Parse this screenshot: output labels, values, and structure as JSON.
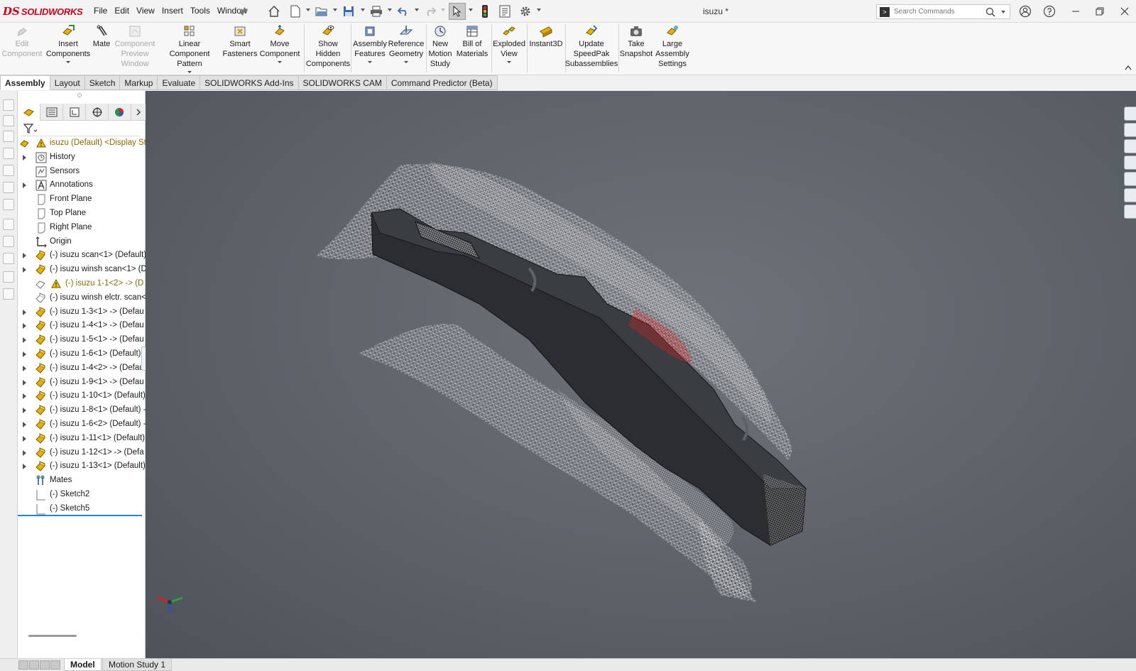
{
  "app": {
    "brand_mark": "DS",
    "brand_name": "SOLIDWORKS",
    "document_title": "isuzu *"
  },
  "menus": [
    "File",
    "Edit",
    "View",
    "Insert",
    "Tools",
    "Window"
  ],
  "search": {
    "placeholder": "Search Commands"
  },
  "commands": [
    {
      "label": "Edit\nComponent",
      "enabled": false
    },
    {
      "label": "Insert\nComponents",
      "enabled": true
    },
    {
      "label": "Mate",
      "enabled": true
    },
    {
      "label": "Component\nPreview\nWindow",
      "enabled": false
    },
    {
      "label": "Linear Component\nPattern",
      "enabled": true
    },
    {
      "label": "Smart\nFasteners",
      "enabled": true
    },
    {
      "label": "Move\nComponent",
      "enabled": true
    },
    {
      "label": "Show\nHidden\nComponents",
      "enabled": true
    },
    {
      "label": "Assembly\nFeatures",
      "enabled": true
    },
    {
      "label": "Reference\nGeometry",
      "enabled": true
    },
    {
      "label": "New\nMotion\nStudy",
      "enabled": true
    },
    {
      "label": "Bill of\nMaterials",
      "enabled": true
    },
    {
      "label": "Exploded\nView",
      "enabled": true
    },
    {
      "label": "Instant3D",
      "enabled": true
    },
    {
      "label": "Update\nSpeedPak\nSubassemblies",
      "enabled": true
    },
    {
      "label": "Take\nSnapshot",
      "enabled": true
    },
    {
      "label": "Large\nAssembly\nSettings",
      "enabled": true
    }
  ],
  "command_tabs": [
    "Assembly",
    "Layout",
    "Sketch",
    "Markup",
    "Evaluate",
    "SOLIDWORKS Add-Ins",
    "SOLIDWORKS CAM",
    "Command Predictor (Beta)"
  ],
  "active_command_tab": "Assembly",
  "tree": [
    {
      "label": "isuzu (Default) <Display St",
      "icon": "assembly-warning-icon",
      "expandable": false,
      "kind": "root"
    },
    {
      "label": "History",
      "icon": "history-icon",
      "expandable": true
    },
    {
      "label": "Sensors",
      "icon": "sensors-icon",
      "expandable": false
    },
    {
      "label": "Annotations",
      "icon": "annotations-icon",
      "expandable": true
    },
    {
      "label": "Front Plane",
      "icon": "plane-icon",
      "expandable": false
    },
    {
      "label": "Top Plane",
      "icon": "plane-icon",
      "expandable": false
    },
    {
      "label": "Right Plane",
      "icon": "plane-icon",
      "expandable": false
    },
    {
      "label": "Origin",
      "icon": "origin-icon",
      "expandable": false
    },
    {
      "label": "(-) isuzu scan<1> (Default)",
      "icon": "part-icon",
      "expandable": true
    },
    {
      "label": "(-) isuzu winsh scan<1> (D",
      "icon": "part-icon",
      "expandable": true
    },
    {
      "label": "(-) isuzu 1-1<2> -> (D",
      "icon": "part-hidden-warning-icon",
      "expandable": false,
      "kind": "warn"
    },
    {
      "label": "(-) isuzu winsh elctr. scan<",
      "icon": "part-hidden-icon",
      "expandable": false
    },
    {
      "label": "(-) isuzu 1-3<1> -> (Defau",
      "icon": "part-icon",
      "expandable": true
    },
    {
      "label": "(-) isuzu 1-4<1> -> (Defau",
      "icon": "part-icon",
      "expandable": true
    },
    {
      "label": "(-) isuzu 1-5<1> -> (Defau",
      "icon": "part-icon",
      "expandable": true
    },
    {
      "label": "(-) isuzu 1-6<1> (Default) -",
      "icon": "part-icon",
      "expandable": true
    },
    {
      "label": "(-) isuzu 1-4<2> -> (Defau",
      "icon": "part-icon",
      "expandable": true
    },
    {
      "label": "(-) isuzu 1-9<1> -> (Defau",
      "icon": "part-icon",
      "expandable": true
    },
    {
      "label": "(-) isuzu 1-10<1> (Default)",
      "icon": "part-icon",
      "expandable": true
    },
    {
      "label": "(-) isuzu 1-8<1> (Default) -",
      "icon": "part-icon",
      "expandable": true
    },
    {
      "label": "(-) isuzu 1-6<2> (Default) -",
      "icon": "part-icon",
      "expandable": true
    },
    {
      "label": "(-) isuzu 1-11<1> (Default)",
      "icon": "part-icon",
      "expandable": true
    },
    {
      "label": "(-) isuzu 1-12<1> -> (Defa",
      "icon": "part-icon",
      "expandable": true
    },
    {
      "label": "(-) isuzu 1-13<1> (Default)",
      "icon": "part-icon",
      "expandable": true
    },
    {
      "label": "Mates",
      "icon": "mates-icon",
      "expandable": false
    },
    {
      "label": "(-) Sketch2",
      "icon": "sketch-icon",
      "expandable": false
    },
    {
      "label": "(-) Sketch5",
      "icon": "sketch-icon",
      "expandable": false
    }
  ],
  "bottom_tabs": [
    "Model",
    "Motion Study 1"
  ],
  "active_bottom_tab": "Model",
  "colors": {
    "brand": "#d0021b",
    "selection": "#2b7fd6",
    "viewport_bg": "#5d6269",
    "part_icon": "#e8b100"
  }
}
